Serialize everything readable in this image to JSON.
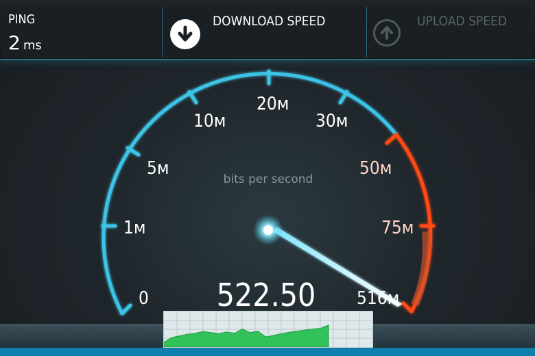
{
  "header": {
    "ping": {
      "label": "PING",
      "value": "2",
      "unit": "ms"
    },
    "download": {
      "label": "DOWNLOAD SPEED",
      "icon": "download-arrow-icon"
    },
    "upload": {
      "label": "UPLOAD SPEED",
      "icon": "upload-arrow-icon"
    }
  },
  "gauge": {
    "unit_caption": "bits per second",
    "tick_labels": [
      "0",
      "1м",
      "5м",
      "10м",
      "20м",
      "30м",
      "50м",
      "75м",
      "516м"
    ],
    "readout": "522.50",
    "needle_value_fraction": 0.96
  },
  "colors": {
    "cool_arc": "#3ec3e6",
    "hot_arc": "#ff4a12",
    "graph_fill": "#32c25a",
    "accent_bar": "#0f7fae"
  },
  "graph": {
    "samples": [
      0.1,
      0.32,
      0.4,
      0.47,
      0.52,
      0.6,
      0.55,
      0.5,
      0.58,
      0.52,
      0.72,
      0.55,
      0.62,
      0.35,
      0.42,
      0.5,
      0.57,
      0.62,
      0.67,
      0.72,
      0.75,
      0.9
    ]
  }
}
